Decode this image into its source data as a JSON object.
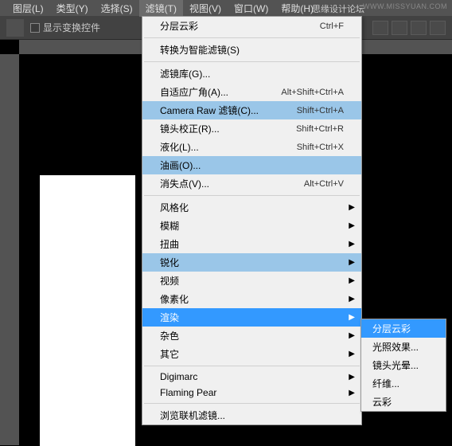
{
  "watermark": "WWW.MISSYUAN.COM",
  "forum_label": "思缘设计论坛",
  "menubar": {
    "items": [
      {
        "label": "图层(L)"
      },
      {
        "label": "类型(Y)"
      },
      {
        "label": "选择(S)"
      },
      {
        "label": "滤镜(T)"
      },
      {
        "label": "视图(V)"
      },
      {
        "label": "窗口(W)"
      },
      {
        "label": "帮助(H)"
      }
    ]
  },
  "toolbar": {
    "checkbox_label": "显示变换控件"
  },
  "dropdown": {
    "groups": [
      [
        {
          "label": "分层云彩",
          "shortcut": "Ctrl+F"
        }
      ],
      [
        {
          "label": "转换为智能滤镜(S)"
        }
      ],
      [
        {
          "label": "滤镜库(G)..."
        },
        {
          "label": "自适应广角(A)...",
          "shortcut": "Alt+Shift+Ctrl+A"
        },
        {
          "label": "Camera Raw 滤镜(C)...",
          "shortcut": "Shift+Ctrl+A",
          "hover": true
        },
        {
          "label": "镜头校正(R)...",
          "shortcut": "Shift+Ctrl+R"
        },
        {
          "label": "液化(L)...",
          "shortcut": "Shift+Ctrl+X"
        },
        {
          "label": "油画(O)...",
          "hover": true
        },
        {
          "label": "消失点(V)...",
          "shortcut": "Alt+Ctrl+V"
        }
      ],
      [
        {
          "label": "风格化",
          "submenu": true
        },
        {
          "label": "模糊",
          "submenu": true
        },
        {
          "label": "扭曲",
          "submenu": true
        },
        {
          "label": "锐化",
          "submenu": true,
          "hover": true
        },
        {
          "label": "视频",
          "submenu": true
        },
        {
          "label": "像素化",
          "submenu": true
        },
        {
          "label": "渲染",
          "submenu": true,
          "selected": true
        },
        {
          "label": "杂色",
          "submenu": true
        },
        {
          "label": "其它",
          "submenu": true
        }
      ],
      [
        {
          "label": "Digimarc",
          "submenu": true
        },
        {
          "label": "Flaming Pear",
          "submenu": true
        }
      ],
      [
        {
          "label": "浏览联机滤镜..."
        }
      ]
    ]
  },
  "submenu": {
    "items": [
      {
        "label": "分层云彩",
        "selected": true
      },
      {
        "label": "光照效果..."
      },
      {
        "label": "镜头光晕..."
      },
      {
        "label": "纤维..."
      },
      {
        "label": "云彩"
      }
    ]
  }
}
